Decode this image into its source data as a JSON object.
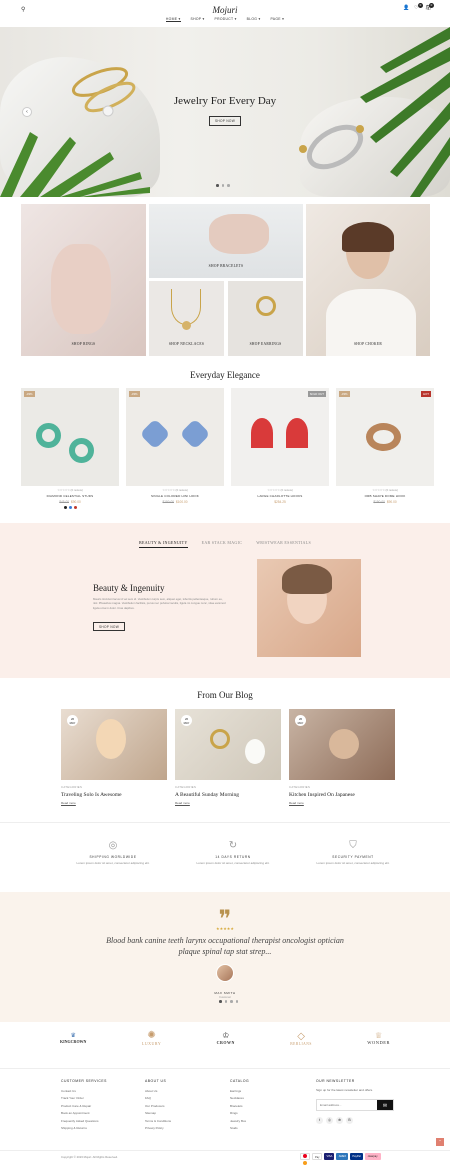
{
  "header": {
    "logo": "Mojuri",
    "nav": [
      "HOME ▾",
      "SHOP ▾",
      "PRODUCT ▾",
      "BLOG ▾",
      "PAGE ▾"
    ],
    "wishlist_count": "0",
    "cart_count": "0"
  },
  "hero": {
    "title": "Jewelry For Every Day",
    "button": "SHOP NOW"
  },
  "categories": [
    "SHOP RINGS",
    "SHOP BRACELETS",
    "SHOP NECKLACES",
    "SHOP EARRINGS",
    "SHOP CHOKER"
  ],
  "everyday": {
    "title": "Everyday Elegance",
    "products": [
      {
        "tag": "-33%",
        "tag2": "",
        "rating": "☆☆☆☆☆ (0 review)",
        "name": "DIAMOND CELESTIAL STUDS",
        "old": "$45.00",
        "price": "$90.00",
        "swatches": [
          "#222",
          "#3a7bd5",
          "#c0392b"
        ]
      },
      {
        "tag": "-33%",
        "tag2": "",
        "rating": "☆☆☆☆☆ (0 review)",
        "name": "SINGLE COLORED HINI HOOK",
        "old": "$150.00",
        "price": "$100.00",
        "swatches": []
      },
      {
        "tag": "",
        "tag2": "SOLD OUT",
        "rating": "☆☆☆☆☆ (0 review)",
        "name": "LARGE CHARLOTTE HOOKS",
        "old": "",
        "price": "$254.25",
        "swatches": []
      },
      {
        "tag": "-33%",
        "tag2": "HOT",
        "rating": "☆☆☆☆☆ (0 review)",
        "name": "ORB SHAPE DOME HOOK",
        "old": "$150.00",
        "price": "$90.00",
        "swatches": []
      }
    ]
  },
  "tabs": [
    "BEAUTY & INGENUITY",
    "EAR STACK MAGIC",
    "WRISTWEAR ESSENTIALS"
  ],
  "feature": {
    "title": "Beauty & Ingenuity",
    "text": "Mauris tincidunt lacus id vel sem id. Vestibulum turpis sem, aliquet eget, lobortis pellentesque, rutrum eu, nisl. Phasellus magna. Vestibulum facilisis, purus nec pulvinar iaculis, ligula mi congue nunc, vitae euismod ligula urna in dolor. Cras dapibus.",
    "button": "SHOP NOW"
  },
  "blog": {
    "title": "From Our Blog",
    "posts": [
      {
        "day": "26",
        "mon": "MAY",
        "cat": "CATEGORIES",
        "title": "Traveling Solo Is Awesome",
        "more": "Read more"
      },
      {
        "day": "26",
        "mon": "MAY",
        "cat": "CATEGORIES",
        "title": "A Beautiful Sunday Morning",
        "more": "Read more"
      },
      {
        "day": "26",
        "mon": "MAY",
        "cat": "CATEGORIES",
        "title": "Kitchen Inspired On Japanese",
        "more": "Read more"
      }
    ]
  },
  "features": [
    {
      "title": "SHIPPING WORLDWIDE",
      "desc": "Lorem ipsum dolor sit amet, consectetur adipiscing elit."
    },
    {
      "title": "14 DAYS RETURN",
      "desc": "Lorem ipsum dolor sit amet, consectetur adipiscing elit."
    },
    {
      "title": "SECURITY PAYMENT",
      "desc": "Lorem ipsum dolor sit amet, consectetur adipiscing elit."
    }
  ],
  "testimonial": {
    "stars": "★★★★★",
    "quote": "Blood bank canine teeth larynx occupational therapist oncologist optician plaque spinal tap stat strep...",
    "author": "MAX SMITH",
    "role": "Customer"
  },
  "brands": [
    "KINGCROWN",
    "LUXURY",
    "CROWN",
    "BERLIANS",
    "WONDER"
  ],
  "footer": {
    "cols": [
      {
        "h": "CUSTOMER SERVICES",
        "items": [
          "Contact Us",
          "Track Your Order",
          "Product Care & Repair",
          "Book an Appointment",
          "Frequently Asked Questions",
          "Shipping & Returns"
        ]
      },
      {
        "h": "ABOUT US",
        "items": [
          "About Us",
          "FAQ",
          "Our Producers",
          "Sitemap",
          "Terms & Conditions",
          "Privacy Policy"
        ]
      },
      {
        "h": "CATALOG",
        "items": [
          "Earrings",
          "Necklaces",
          "Bracelets",
          "Rings",
          "Jewelry Box",
          "Studs"
        ]
      }
    ],
    "newsletter": {
      "h": "OUR NEWSLETTER",
      "text": "Sign up for the latest newsletter and offers.",
      "placeholder": "Email address..."
    },
    "copyright": "Copyright © 2023 Mojuri. All Rights Reserved.",
    "payments": [
      "PayPal",
      "VISA",
      "",
      "AMEX",
      ""
    ]
  }
}
